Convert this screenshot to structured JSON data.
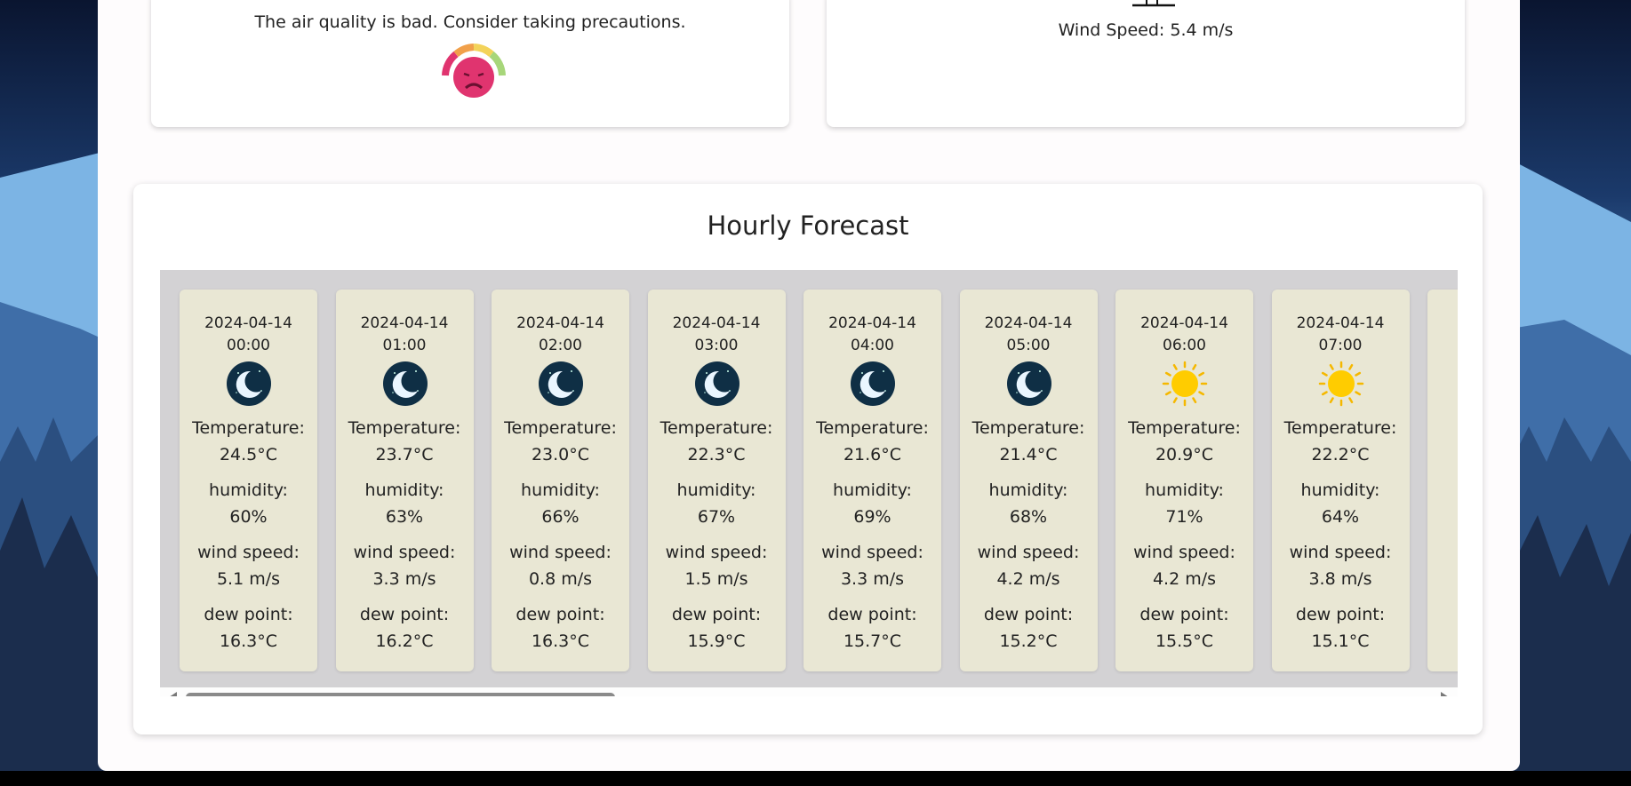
{
  "air_quality": {
    "message": "The air quality is bad. Consider taking precautions.",
    "icon": "sad-face-aqi-gauge-icon"
  },
  "wind": {
    "label": "Wind Speed: 5.4 m/s",
    "icon": "wind-icon"
  },
  "forecast": {
    "title": "Hourly Forecast",
    "labels": {
      "temperature": "Temperature:",
      "humidity": "humidity:",
      "wind_speed": "wind speed:",
      "dew_point": "dew point:"
    },
    "hours": [
      {
        "date": "2024-04-14",
        "time": "00:00",
        "icon": "moon-icon",
        "temperature": "24.5°C",
        "humidity": "60%",
        "wind_speed": "5.1 m/s",
        "dew_point": "16.3°C"
      },
      {
        "date": "2024-04-14",
        "time": "01:00",
        "icon": "moon-icon",
        "temperature": "23.7°C",
        "humidity": "63%",
        "wind_speed": "3.3 m/s",
        "dew_point": "16.2°C"
      },
      {
        "date": "2024-04-14",
        "time": "02:00",
        "icon": "moon-icon",
        "temperature": "23.0°C",
        "humidity": "66%",
        "wind_speed": "0.8 m/s",
        "dew_point": "16.3°C"
      },
      {
        "date": "2024-04-14",
        "time": "03:00",
        "icon": "moon-icon",
        "temperature": "22.3°C",
        "humidity": "67%",
        "wind_speed": "1.5 m/s",
        "dew_point": "15.9°C"
      },
      {
        "date": "2024-04-14",
        "time": "04:00",
        "icon": "moon-icon",
        "temperature": "21.6°C",
        "humidity": "69%",
        "wind_speed": "3.3 m/s",
        "dew_point": "15.7°C"
      },
      {
        "date": "2024-04-14",
        "time": "05:00",
        "icon": "moon-icon",
        "temperature": "21.4°C",
        "humidity": "68%",
        "wind_speed": "4.2 m/s",
        "dew_point": "15.2°C"
      },
      {
        "date": "2024-04-14",
        "time": "06:00",
        "icon": "sun-icon",
        "temperature": "20.9°C",
        "humidity": "71%",
        "wind_speed": "4.2 m/s",
        "dew_point": "15.5°C"
      },
      {
        "date": "2024-04-14",
        "time": "07:00",
        "icon": "sun-icon",
        "temperature": "22.2°C",
        "humidity": "64%",
        "wind_speed": "3.8 m/s",
        "dew_point": "15.1°C"
      }
    ]
  },
  "colors": {
    "card_bg": "#e9e7d4",
    "track_bg": "#d3d2d4",
    "aqi_face": "#e0346f"
  }
}
